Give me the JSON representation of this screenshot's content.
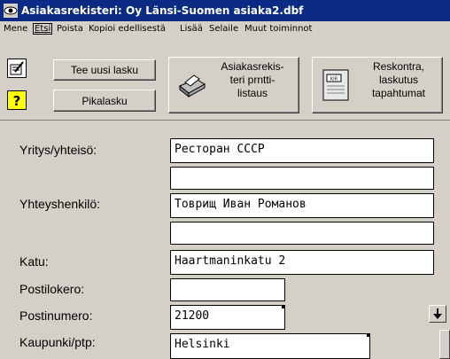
{
  "window": {
    "title": "Asiakasrekisteri: Oy Länsi-Suomen asiaka2.dbf"
  },
  "menu": {
    "items": [
      "Mene",
      "Etsi",
      "Poista",
      "Kopioi edellisestä",
      "Lisää",
      "Selaile",
      "Muut toiminnot"
    ]
  },
  "toolbar": {
    "new_invoice_label": "Tee uusi lasku",
    "quick_invoice_label": "Pikalasku",
    "customer_print_label": [
      "Asiakasrekis-",
      "teri prntti-",
      "listaus"
    ],
    "ledger_label": [
      "Reskontra,",
      "laskutus",
      "tapahtumat"
    ],
    "ledger_icon_text": "KIR"
  },
  "form": {
    "company_label": "Yritys/yhteisö:",
    "company_value": "Ресторан СССР",
    "company_value2": "",
    "contact_label": "Yhteyshenkilö:",
    "contact_value": "Товрищ Иван Романов",
    "contact_value2": "",
    "street_label": "Katu:",
    "street_value": "Haartmaninkatu 2",
    "pobox_label": "Postilokero:",
    "pobox_value": "",
    "postal_label": "Postinumero:",
    "postal_value": "21200",
    "city_label": "Kaupunki/ptp:",
    "city_value": "Helsinki"
  },
  "colors": {
    "titlebar": "#0a2a84",
    "face": "#d4d0c8"
  }
}
